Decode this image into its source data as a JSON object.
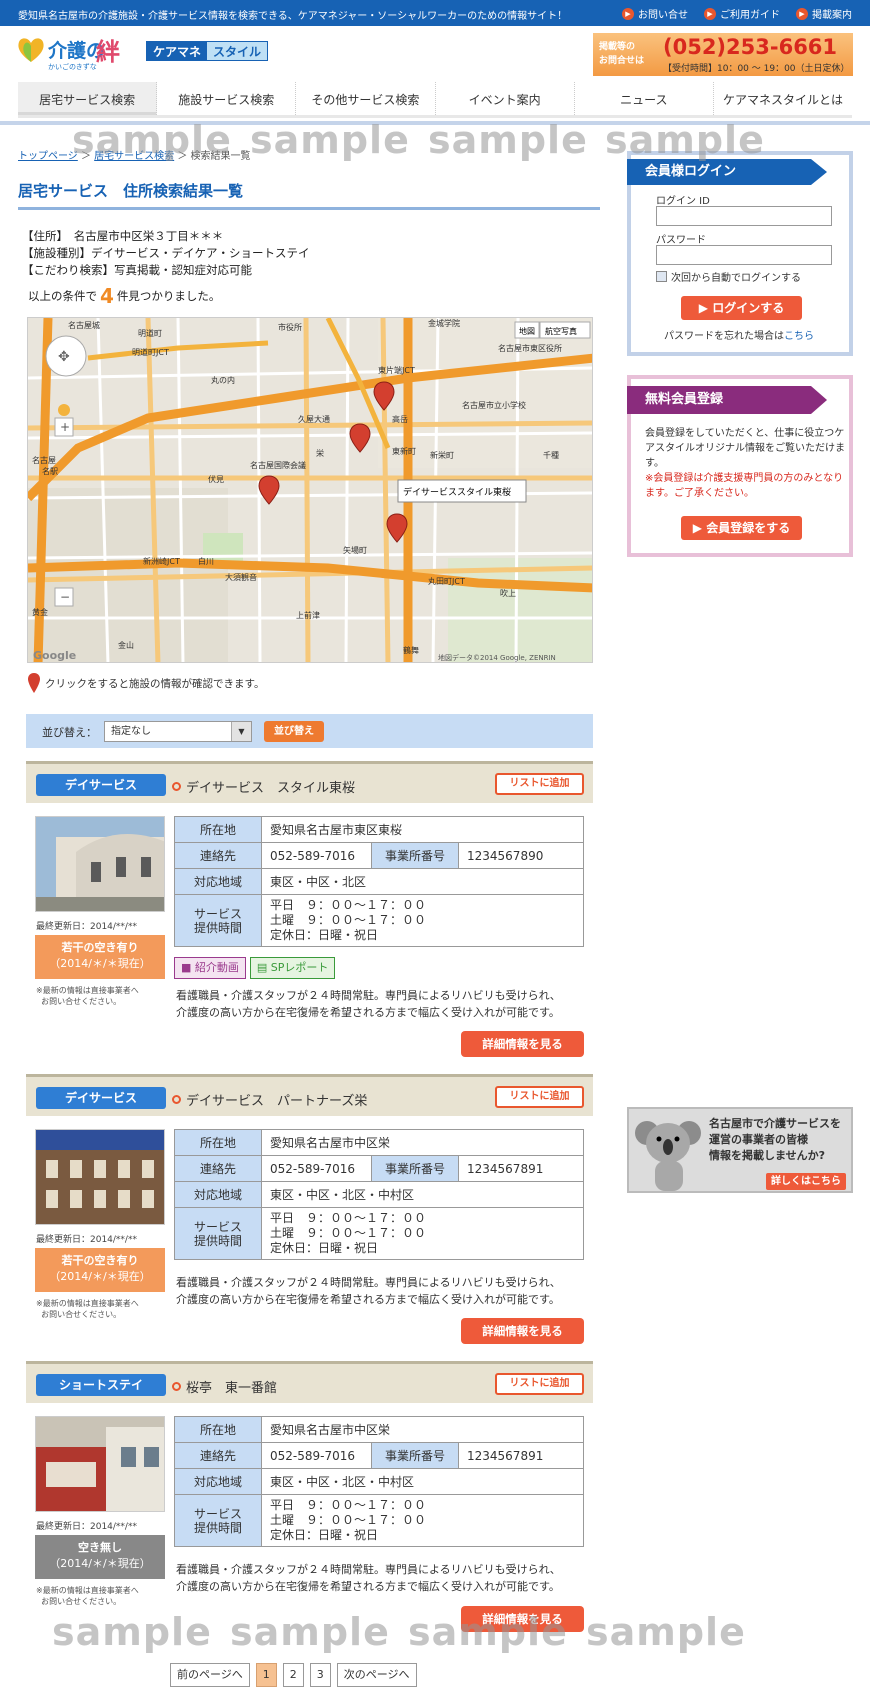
{
  "topbar": {
    "tagline": "愛知県名古屋市の介護施設・介護サービス情報を検索できる、ケアマネジャー・ソーシャルワーカーのための情報サイト！",
    "links": [
      "お問い合せ",
      "ご利用ガイド",
      "掲載案内"
    ]
  },
  "logo": {
    "main1": "介護の",
    "main2": "絆",
    "sub": "かいごのきずな",
    "cm1": "ケアマネ",
    "cm2": "スタイル"
  },
  "phone": {
    "label1": "掲載等の",
    "label2": "お問合せは",
    "number": "(052)253-6661",
    "hours": "【受付時間】10：00 ～ 19：00（土日定休）"
  },
  "nav": [
    "居宅サービス検索",
    "施設サービス検索",
    "その他サービス検索",
    "イベント案内",
    "ニュース",
    "ケアマネスタイルとは"
  ],
  "breadcrumb": {
    "home": "トップページ",
    "mid": "居宅サービス検索",
    "current": "検索結果一覧"
  },
  "watermark": "sample",
  "page_title": "居宅サービス　住所検索結果一覧",
  "conditions": [
    "【住所】　名古屋市中区栄３丁目＊＊＊",
    "【施設種別】デイサービス・デイケア・ショートステイ",
    "【こだわり検索】写真掲載・認知症対応可能"
  ],
  "found": {
    "pre": "以上の条件で",
    "count": "4",
    "post": "件見つかりました。"
  },
  "map": {
    "btn_map": "地図",
    "btn_sat": "航空写真",
    "popup": "デイサービススタイル東桜",
    "copyright": "地図データ©2014 Google, ZENRIN",
    "google": "Google",
    "labels": [
      "名古屋城",
      "明道町",
      "明道町JCT",
      "市役所",
      "金城学院",
      "名古屋市東区役所",
      "東片端JCT",
      "丸の内",
      "名古屋国際会議",
      "名古屋市立小学校",
      "高岳",
      "久屋大通",
      "東新町",
      "新栄町",
      "千種",
      "伏見",
      "栄",
      "矢場町",
      "大須観音",
      "上前津",
      "鶴舞",
      "金山",
      "名古屋",
      "名駅",
      "吹上",
      "白川",
      "丸田町JCT",
      "新洲崎JCT",
      "黄金"
    ]
  },
  "map_hint": "クリックをすると施設の情報が確認できます。",
  "sort": {
    "label": "並び替え：",
    "value": "指定なし",
    "button": "並び替え"
  },
  "labels": {
    "address": "所在地",
    "contact": "連絡先",
    "office": "事業所番号",
    "area": "対応地域",
    "service1": "サービス",
    "service2": "提供時間",
    "list_add": "リストに追加",
    "detail": "詳細情報を見る",
    "video": "紹介動画",
    "report": "SPレポート",
    "note1": "※最新の情報は直接事業者へ",
    "note2": "お問い合せください。"
  },
  "cards": [
    {
      "category": "デイサービス",
      "name": "デイサービス　スタイル東桜",
      "address": "愛知県名古屋市東区東桜",
      "phone": "052-589-7016",
      "office_no": "1234567890",
      "area": "東区・中区・北区",
      "hours": [
        "平日　９：００～１７：００",
        "土曜　９：００～１７：００",
        "定休日：日曜・祝日"
      ],
      "updated": "最終更新日：2014/**/**",
      "avail1": "若干の空き有り",
      "avail2": "（2014/＊/＊現在）",
      "desc1": "看護職員・介護スタッフが２４時間常駐。専門員によるリハビリも受けられ、",
      "desc2": "介護度の高い方から在宅復帰を希望される方まで幅広く受け入れが可能です。"
    },
    {
      "category": "デイサービス",
      "name": "デイサービス　パートナーズ栄",
      "address": "愛知県名古屋市中区栄",
      "phone": "052-589-7016",
      "office_no": "1234567891",
      "area": "東区・中区・北区・中村区",
      "hours": [
        "平日　９：００～１７：００",
        "土曜　９：００～１７：００",
        "定休日：日曜・祝日"
      ],
      "updated": "最終更新日：2014/**/**",
      "avail1": "若干の空き有り",
      "avail2": "（2014/＊/＊現在）",
      "desc1": "看護職員・介護スタッフが２４時間常駐。専門員によるリハビリも受けられ、",
      "desc2": "介護度の高い方から在宅復帰を希望される方まで幅広く受け入れが可能です。"
    },
    {
      "category": "ショートステイ",
      "name": "桜亭　東一番館",
      "address": "愛知県名古屋市中区栄",
      "phone": "052-589-7016",
      "office_no": "1234567891",
      "area": "東区・中区・北区・中村区",
      "hours": [
        "平日　９：００～１７：００",
        "土曜　９：００～１７：００",
        "定休日：日曜・祝日"
      ],
      "updated": "最終更新日：2014/**/**",
      "avail1": "空き無し",
      "avail2": "（2014/＊/＊現在）",
      "desc1": "看護職員・介護スタッフが２４時間常駐。専門員によるリハビリも受けられ、",
      "desc2": "介護度の高い方から在宅復帰を希望される方まで幅広く受け入れが可能です。"
    }
  ],
  "pager": {
    "prev": "前のページへ",
    "pages": [
      "1",
      "2",
      "3"
    ],
    "next": "次のページへ"
  },
  "login": {
    "title": "会員様ログイン",
    "id_label": "ログイン ID",
    "pw_label": "パスワード",
    "remember": "次回から自動でログインする",
    "button": "ログインする",
    "forgot": "パスワードを忘れた場合は",
    "forgot_link": "こちら"
  },
  "register": {
    "title": "無料会員登録",
    "text": "会員登録をしていただくと、仕事に役立つケアスタイルオリジナル情報をご覧いただけます。",
    "warn": "※会員登録は介護支援専門員の方のみとなります。ご了承ください。",
    "button": "会員登録をする"
  },
  "ad": {
    "text1": "名古屋市で介護サービスを",
    "text2": "運営の事業者の皆様",
    "text3": "情報を掲載しませんか?",
    "button": "詳しくはこちら"
  },
  "colors": {
    "brand_blue": "#1762b4",
    "accent_orange": "#ee5a3a",
    "avail_orange": "#f39a5b",
    "no_avail_gray": "#888888"
  }
}
